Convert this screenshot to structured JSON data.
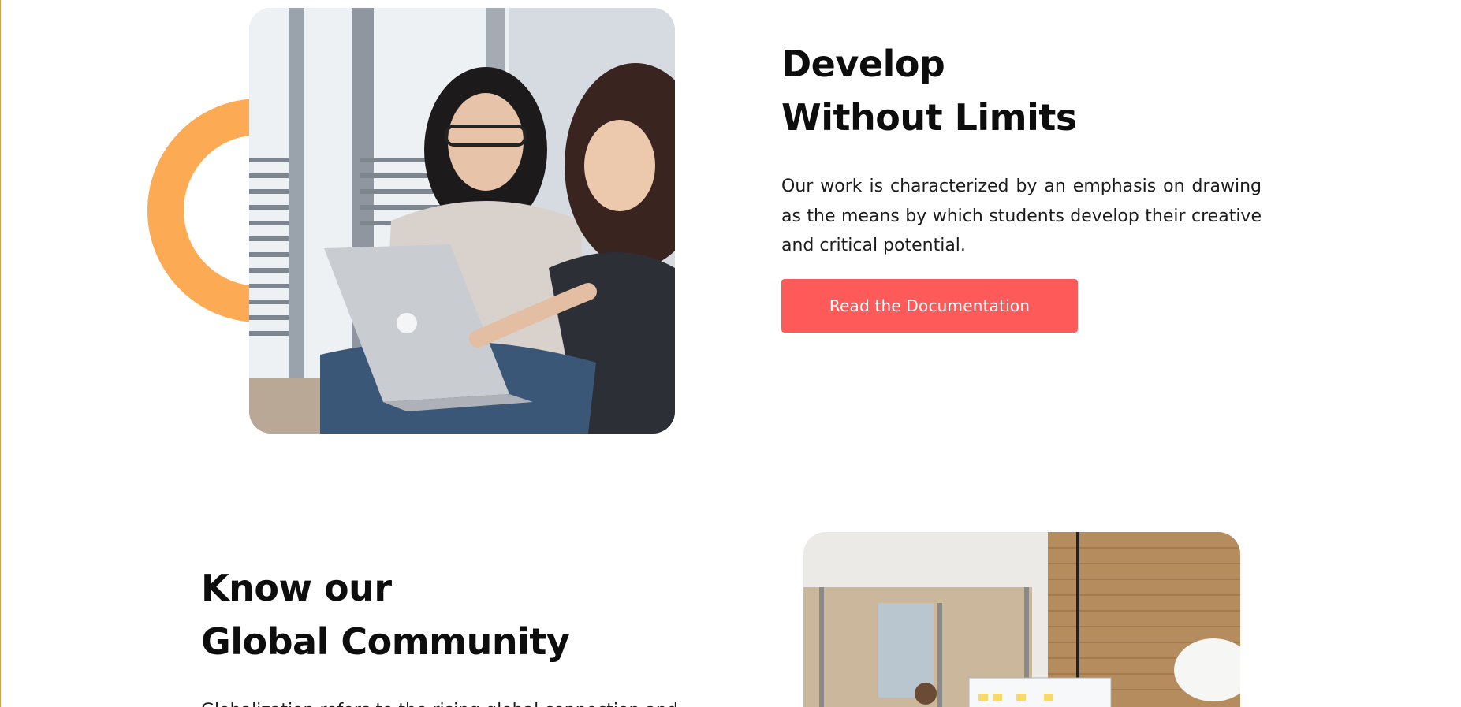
{
  "colors": {
    "ring": "#fdaa55",
    "button": "#fe5a5a",
    "heading": "#0d0d0d"
  },
  "section_develop": {
    "title_line1": "Develop",
    "title_line2": "Without Limits",
    "description": "Our work is characterized by an emphasis on drawing as the means by which students develop their creative and critical potential.",
    "button_label": "Read the Documentation",
    "image": "students-with-laptop-photo"
  },
  "section_community": {
    "title_line1": "Know our",
    "title_line2": "Global Community",
    "description_partial": "Globalization refers to the rising global connection and",
    "image": "office-team-whiteboard-photo"
  }
}
